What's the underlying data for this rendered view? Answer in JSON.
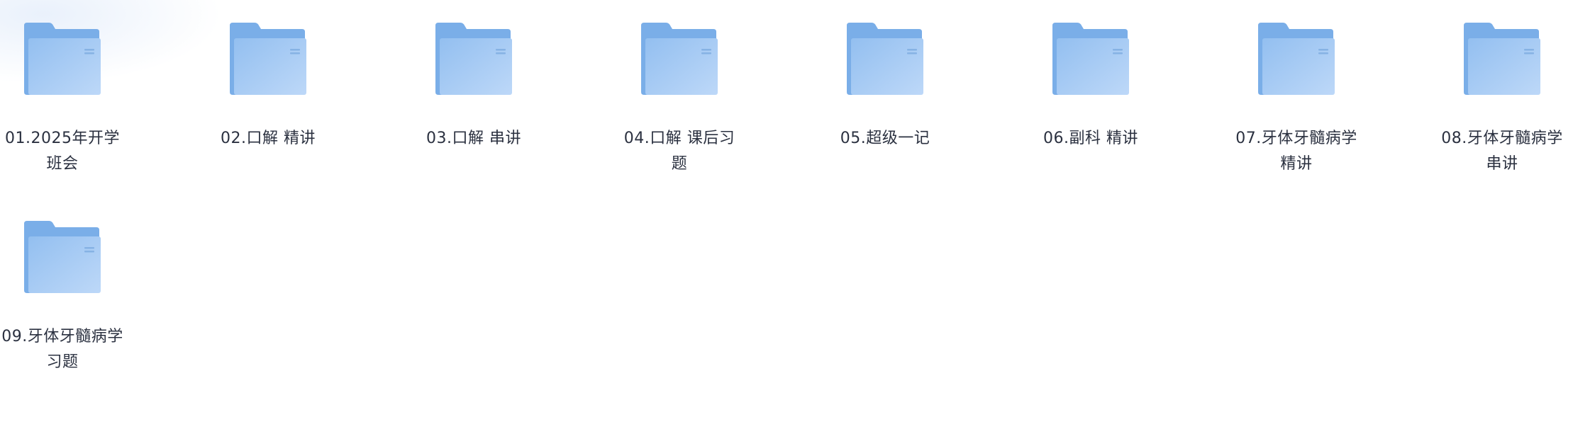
{
  "folders": [
    {
      "name": "01.2025年开学班会"
    },
    {
      "name": "02.口解 精讲"
    },
    {
      "name": "03.口解 串讲"
    },
    {
      "name": "04.口解 课后习题"
    },
    {
      "name": "05.超级一记"
    },
    {
      "name": "06.副科 精讲"
    },
    {
      "name": "07.牙体牙髓病学 精讲"
    },
    {
      "name": "08.牙体牙髓病学 串讲"
    },
    {
      "name": "09.牙体牙髓病学 习题"
    }
  ],
  "colors": {
    "folder_back": "#7aaee8",
    "folder_front_top": "#94c0f0",
    "folder_front_bottom": "#b9d6f7",
    "label_text": "#2b3140"
  },
  "icon": "folder-icon"
}
